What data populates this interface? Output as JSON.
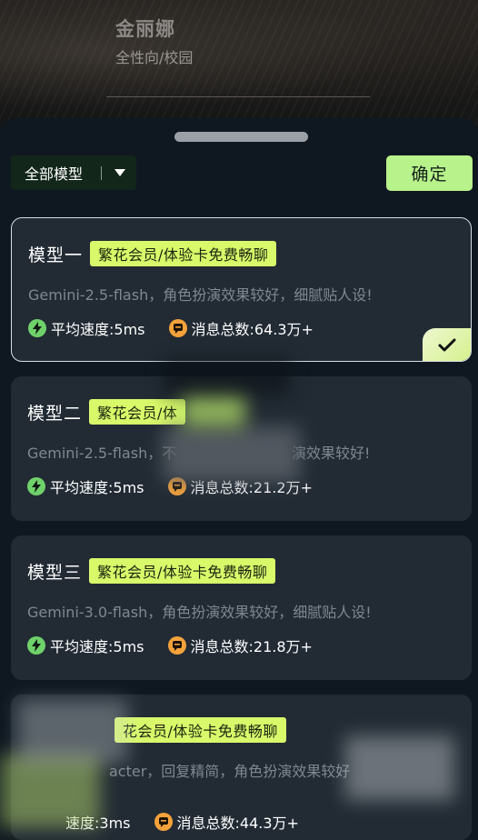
{
  "character": {
    "name": "金丽娜",
    "tags": "全性向/校园"
  },
  "toolbar": {
    "filter_label": "全部模型",
    "confirm_label": "确定"
  },
  "models": [
    {
      "title": "模型一",
      "badge": "繁花会员/体验卡免费畅聊",
      "desc": "Gemini-2.5-flash，角色扮演效果较好，细腻贴人设!",
      "speed": "平均速度:5ms",
      "messages": "消息总数:64.3万+",
      "selected": true
    },
    {
      "title": "模型二",
      "badge": "繁花会员/体",
      "desc": "Gemini-2.5-flash，不",
      "desc_tail": "演效果较好!",
      "speed": "平均速度:5ms",
      "messages": "消息总数:21.2万+",
      "selected": false
    },
    {
      "title": "模型三",
      "badge": "繁花会员/体验卡免费畅聊",
      "desc": "Gemini-3.0-flash，角色扮演效果较好，细腻贴人设!",
      "speed": "平均速度:5ms",
      "messages": "消息总数:21.8万+",
      "selected": false
    },
    {
      "title": "",
      "badge": "花会员/体验卡免费畅聊",
      "desc": "acter，回复精简，角色扮演效果较好",
      "speed": "速度:3ms",
      "messages": "消息总数:44.3万+",
      "selected": false
    }
  ],
  "colors": {
    "accent": "#b7f28a",
    "badge": "#d9f96a",
    "card_bg": "#222b34",
    "sheet_bg": "#0f1821",
    "speed_icon": "#6fd16a",
    "message_icon": "#f4a23b"
  }
}
